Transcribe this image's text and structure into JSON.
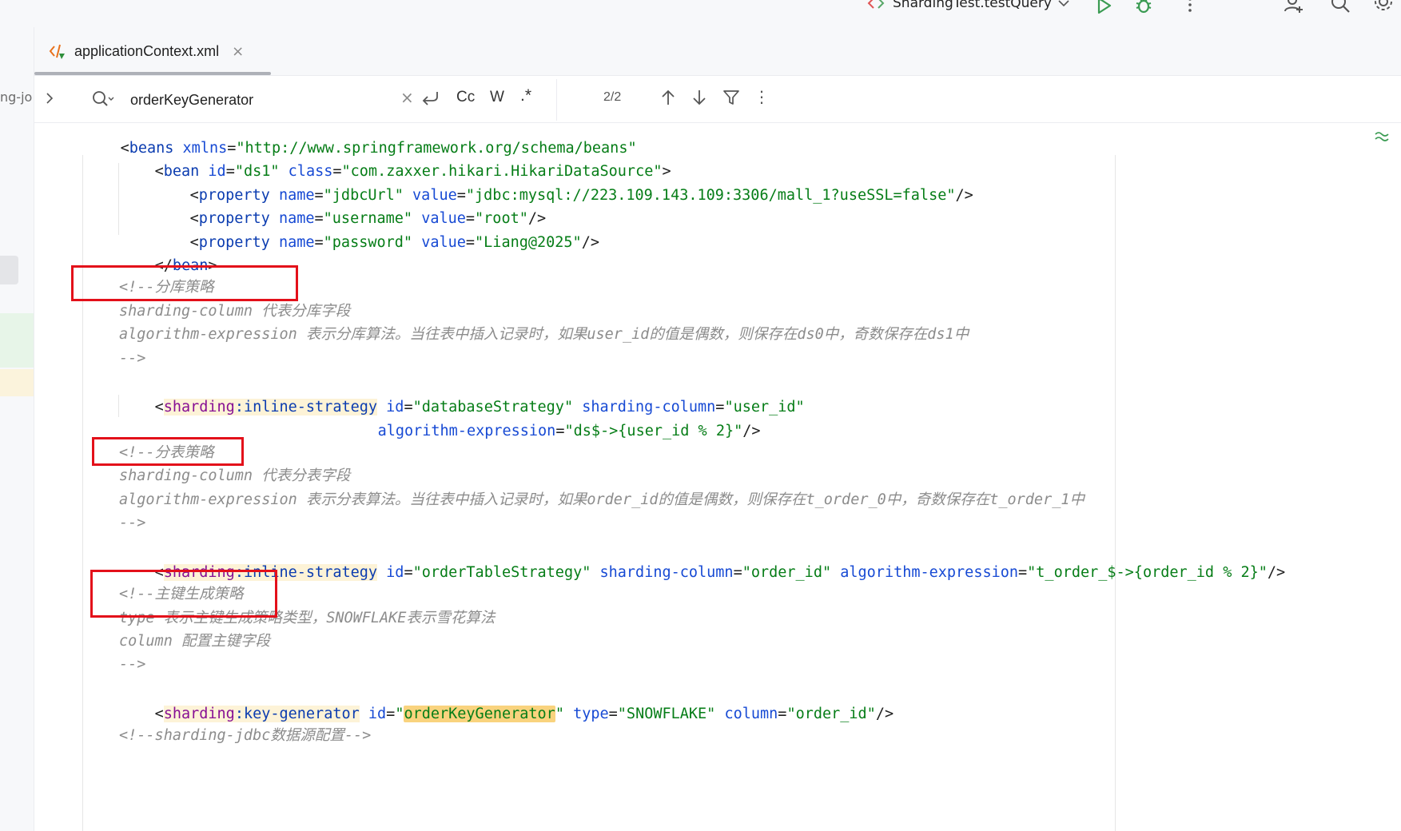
{
  "toolbar": {
    "run_config_label": "ShardingTest.testQuery",
    "icons": [
      "run-config-icon",
      "chevron-down-icon",
      "run-icon",
      "debug-icon",
      "more-vertical-icon",
      "add-user-icon",
      "search-icon",
      "settings-icon"
    ]
  },
  "left_strip": {
    "project_fragment": "ng-jo"
  },
  "tab": {
    "label": "applicationContext.xml",
    "close": "×"
  },
  "search": {
    "query": "orderKeyGenerator",
    "clear": "×",
    "match_case": "Cc",
    "whole_words": "W",
    "regex": ".*",
    "match_count": "2/2"
  },
  "code": {
    "l1": {
      "open": "<",
      "tag": "beans",
      "attr": "xmlns",
      "eq": "=",
      "value": "\"http://www.springframework.org/schema/beans\""
    },
    "l2": {
      "open": "<",
      "tag": "bean",
      "attr1": "id",
      "value1": "\"ds1\"",
      "attr2": "class",
      "value2": "\"com.zaxxer.hikari.HikariDataSource\"",
      "close": ">"
    },
    "l3": {
      "tag": "property",
      "attr1": "name",
      "value1": "\"jdbcUrl\"",
      "attr2": "value",
      "value2": "\"jdbc:mysql://223.109.143.109:3306/mall_1?useSSL=false\"",
      "close": "/>"
    },
    "l4": {
      "tag": "property",
      "attr1": "name",
      "value1": "\"username\"",
      "attr2": "value",
      "value2": "\"root\"",
      "close": "/>"
    },
    "l5": {
      "tag": "property",
      "attr1": "name",
      "value1": "\"password\"",
      "attr2": "value",
      "value2": "\"Liang@2025\"",
      "close": "/>"
    },
    "l6": {
      "close_tag": "bean"
    },
    "c1": [
      "<!--分库策略",
      "sharding-column 代表分库字段",
      "algorithm-expression 表示分库算法。当往表中插入记录时，如果user_id的值是偶数，则保存在ds0中，奇数保存在ds1中",
      "-->"
    ],
    "l7": {
      "ns": "sharding",
      "name": "inline-strategy",
      "attr1": "id",
      "value1": "\"databaseStrategy\"",
      "attr2": "sharding-column",
      "value2": "\"user_id\""
    },
    "l8": {
      "attr": "algorithm-expression",
      "value": "\"ds$->{user_id % 2}\"",
      "close": "/>"
    },
    "c2": [
      "<!--分表策略",
      "sharding-column 代表分表字段",
      "algorithm-expression 表示分表算法。当往表中插入记录时，如果order_id的值是偶数，则保存在t_order_0中，奇数保存在t_order_1中",
      "-->"
    ],
    "l9": {
      "ns": "sharding",
      "name": "inline-strategy",
      "attr1": "id",
      "value1": "\"orderTableStrategy\"",
      "attr2": "sharding-column",
      "value2": "\"order_id\"",
      "attr3": "algorithm-expression",
      "value3": "\"t_order_$->{order_id % 2}\"",
      "close": "/>"
    },
    "c3": [
      "<!--主键生成策略",
      "type 表示主键生成策略类型，SNOWFLAKE表示雪花算法",
      "column 配置主键字段",
      "-->"
    ],
    "l10": {
      "ns": "sharding",
      "name": "key-generator",
      "attr1": "id",
      "value1_q": "\"",
      "value1_hl": "orderKeyGenerator",
      "attr2": "type",
      "value2": "\"SNOWFLAKE\"",
      "attr3": "column",
      "value3": "\"order_id\"",
      "close": "/>"
    },
    "c4": "<!--sharding-jdbc数据源配置-->"
  },
  "colors": {
    "tag": "#0b3cb0",
    "attr": "#174ad4",
    "value": "#067d17",
    "comment": "#8c8c8c",
    "namespace": "#871094",
    "search_highlight": "#f9d37e",
    "annotation_box": "#e3101a"
  }
}
